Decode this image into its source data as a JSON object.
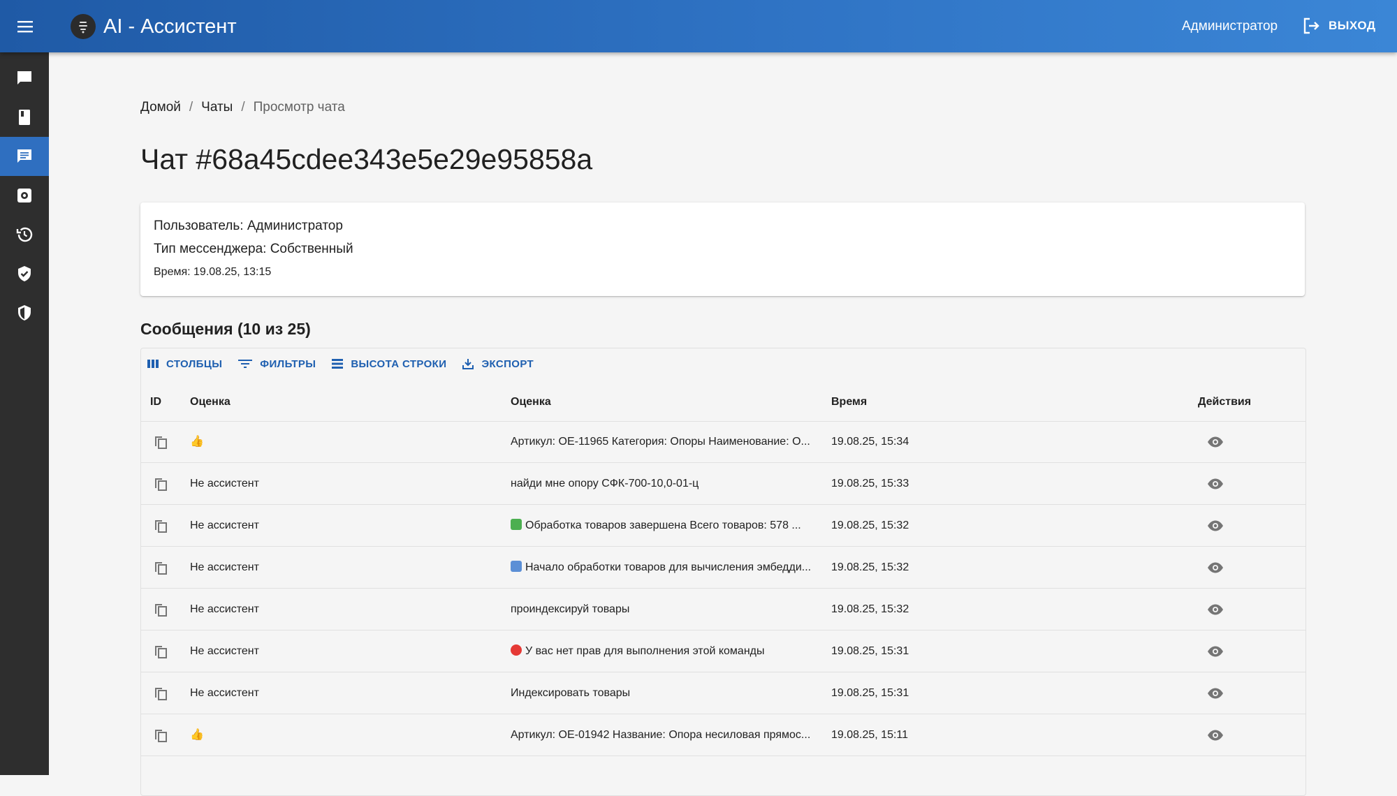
{
  "header": {
    "title": "AI - Ассистент",
    "user": "Администратор",
    "logout_label": "ВЫХОД"
  },
  "sidebar": {
    "items": [
      {
        "icon": "chat-bubble-icon"
      },
      {
        "icon": "book-icon"
      },
      {
        "icon": "chat-list-icon",
        "active": true
      },
      {
        "icon": "settings-icon"
      },
      {
        "icon": "history-icon"
      },
      {
        "icon": "shield-check-icon"
      },
      {
        "icon": "security-icon"
      }
    ]
  },
  "breadcrumb": {
    "home": "Домой",
    "chats": "Чаты",
    "current": "Просмотр чата",
    "separator": "/"
  },
  "page_title": "Чат #68a45cdee343e5e29e95858a",
  "info": {
    "user": "Пользователь: Администратор",
    "messenger": "Тип мессенджера: Собственный",
    "time": "Время: 19.08.25, 13:15"
  },
  "messages": {
    "title": "Сообщения (10 из 25)",
    "toolbar": {
      "columns": "СТОЛБЦЫ",
      "filters": "ФИЛЬТРЫ",
      "row_height": "ВЫСОТА СТРОКИ",
      "export": "ЭКСПОРТ"
    },
    "columns": [
      "ID",
      "Оценка",
      "Оценка",
      "Время",
      "Действия"
    ],
    "rows": [
      {
        "rating": "👍",
        "text": "Артикул: ОЕ-11965 Категория: Опоры Наименование: О...",
        "time": "19.08.25, 15:34"
      },
      {
        "rating": "Не ассистент",
        "text": "найди мне опору СФК-700-10,0-01-ц",
        "time": "19.08.25, 15:33"
      },
      {
        "rating": "Не ассистент",
        "text": "Обработка товаров завершена Всего товаров: 578 ...",
        "time": "19.08.25, 15:32",
        "emoji": "check-emoji"
      },
      {
        "rating": "Не ассистент",
        "text": "Начало обработки товаров для вычисления эмбедди...",
        "time": "19.08.25, 15:32",
        "emoji": "refresh-emoji"
      },
      {
        "rating": "Не ассистент",
        "text": "проиндексируй товары",
        "time": "19.08.25, 15:32"
      },
      {
        "rating": "Не ассистент",
        "text": "У вас нет прав для выполнения этой команды",
        "time": "19.08.25, 15:31",
        "emoji": "no-entry-emoji"
      },
      {
        "rating": "Не ассистент",
        "text": "Индексировать товары",
        "time": "19.08.25, 15:31"
      },
      {
        "rating": "👍",
        "text": "Артикул: ОЕ-01942 Название: Опора несиловая прямос...",
        "time": "19.08.25, 15:11"
      }
    ]
  },
  "colors": {
    "appbar": "#2f73c4",
    "sidebar": "#2e2e2e",
    "active": "#2f6fc0",
    "accent": "#1e5fb0",
    "check_emoji": "#4caf50",
    "refresh_emoji": "#5b8fd6",
    "no_entry_emoji": "#e53935"
  }
}
